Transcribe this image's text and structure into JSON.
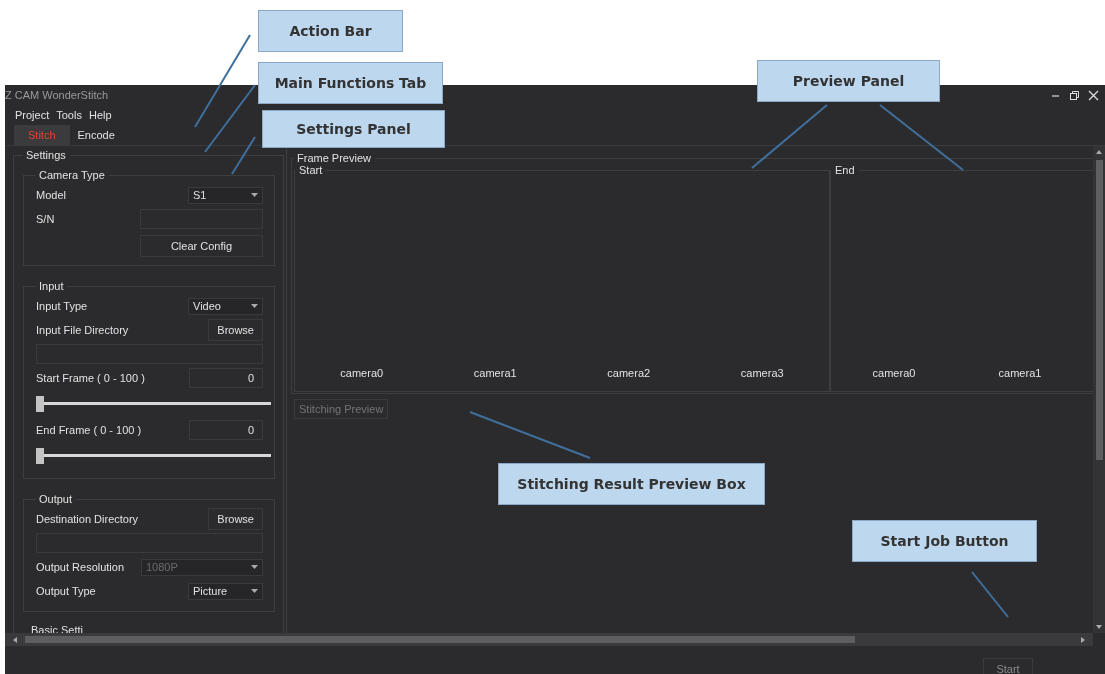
{
  "window": {
    "title": "Z CAM WonderStitch"
  },
  "menu": [
    "Project",
    "Tools",
    "Help"
  ],
  "tabs": [
    {
      "label": "Stitch",
      "selected": true
    },
    {
      "label": "Encode",
      "selected": false
    }
  ],
  "settings": {
    "title": "Settings",
    "groups": [
      {
        "title": "Camera Type",
        "rows": [
          {
            "kind": "select",
            "label": "Model",
            "value": "S1",
            "disabled": false
          },
          {
            "kind": "field",
            "label": "S/N"
          },
          {
            "kind": "button",
            "button": "Clear Config"
          }
        ]
      },
      {
        "title": "Input",
        "rows": [
          {
            "kind": "select",
            "label": "Input Type",
            "value": "Video",
            "disabled": false
          },
          {
            "kind": "browse",
            "label": "Input File Directory",
            "button": "Browse"
          },
          {
            "kind": "path"
          },
          {
            "kind": "number",
            "label": "Start Frame ( 0 - 100 )",
            "value": "0"
          },
          {
            "kind": "slider",
            "level": 0
          },
          {
            "kind": "number",
            "label": "End Frame   ( 0 - 100 )",
            "value": "0"
          },
          {
            "kind": "slider",
            "level": 0
          }
        ]
      },
      {
        "title": "Output",
        "rows": [
          {
            "kind": "browse",
            "label": "Destination Directory",
            "button": "Browse"
          },
          {
            "kind": "path"
          },
          {
            "kind": "select",
            "label": "Output Resolution",
            "value": "1080P",
            "disabled": true
          },
          {
            "kind": "select",
            "label": "Output Type",
            "value": "Picture",
            "disabled": false
          }
        ]
      }
    ],
    "next_group": "Basic Setti"
  },
  "frame_preview": {
    "title": "Frame Preview",
    "panes": [
      {
        "title": "Start",
        "cameras": [
          "camera0",
          "camera1",
          "camera2",
          "camera3"
        ]
      },
      {
        "title": "End",
        "cameras": [
          "camera0",
          "camera1"
        ]
      }
    ]
  },
  "stitching_preview": {
    "label": "Stitching Preview",
    "disabled": true
  },
  "start_button": {
    "label": "Start",
    "disabled": true
  },
  "annotations": [
    "Action Bar",
    "Main Functions Tab",
    "Settings Panel",
    "Preview Panel",
    "Stitching Result Preview Box",
    "Start Job Button"
  ]
}
